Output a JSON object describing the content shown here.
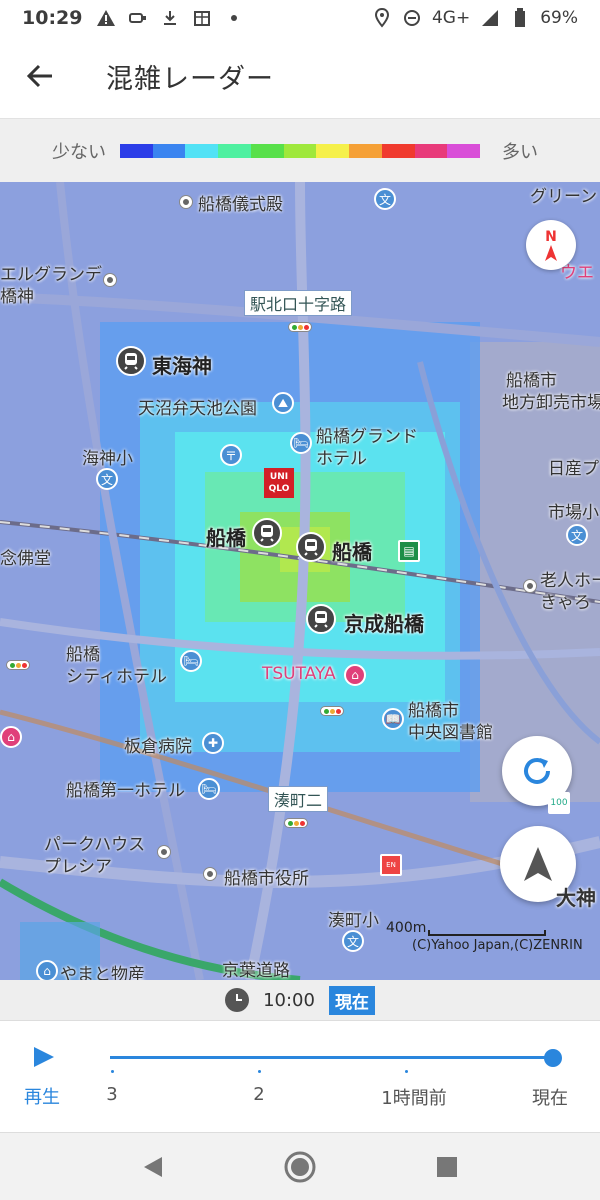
{
  "status_bar": {
    "time": "10:29",
    "network": "4G+",
    "battery": "69%",
    "left_icons": [
      "warning-icon",
      "usb-icon",
      "download-icon",
      "package-icon",
      "dot-icon"
    ],
    "right_icons": [
      "location-icon",
      "do-not-disturb-icon",
      "signal-icon",
      "battery-icon"
    ]
  },
  "app_bar": {
    "title": "混雑レーダー"
  },
  "legend": {
    "low": "少ない",
    "high": "多い",
    "colors": [
      "#2b3de8",
      "#3a84f0",
      "#52e2f5",
      "#4ef0a0",
      "#58e04a",
      "#9fe83c",
      "#f5f04a",
      "#f5a036",
      "#f03a2e",
      "#e83a7a",
      "#d94ed8"
    ]
  },
  "map": {
    "labels": {
      "funabashi_funeral": "船橋儀式殿",
      "green": "グリーン",
      "el_grande": "エルグランデ",
      "funabashi_shrine": "橋神",
      "ue": "ウエ",
      "eki_kita": "駅北口十字路",
      "higashi_kaijin": "東海神",
      "funabashi_market": "船橋市",
      "market2": "地方卸売市場",
      "tennuma": "天沼弁天池公園",
      "kaijin_sho": "海神小",
      "grand_hotel": "船橋グランド",
      "grand_hotel2": "ホテル",
      "nissan": "日産プ",
      "ichiba": "市場小",
      "nenbutsu": "念佛堂",
      "funabashi_a": "船橋",
      "funabashi_b": "船橋",
      "elderly": "老人ホー",
      "kyaro": "きゃろ",
      "keisei": "京成船橋",
      "city_hotel": "船橋",
      "city_hotel2": "シティホテル",
      "tsutaya": "TSUTAYA",
      "library": "船橋市",
      "library2": "中央図書館",
      "itakura": "板倉病院",
      "daiichi_hotel": "船橋第一ホテル",
      "minato2": "湊町二",
      "park_house": "パークハウス",
      "park_house2": "プレシア",
      "city_hall": "船橋市役所",
      "minato_sho": "湊町小",
      "yamato": "やまと物産",
      "keiyo": "京葉道路",
      "ohgami": "大神",
      "uniqlo": "UNI QLO",
      "compass_n": "N"
    },
    "scale": "400m",
    "copyright": "(C)Yahoo Japan,(C)ZENRIN"
  },
  "time_row": {
    "time": "10:00",
    "badge": "現在"
  },
  "timeline": {
    "play_label": "再生",
    "ticks": [
      "3",
      "2",
      "1時間前",
      "現在"
    ]
  }
}
